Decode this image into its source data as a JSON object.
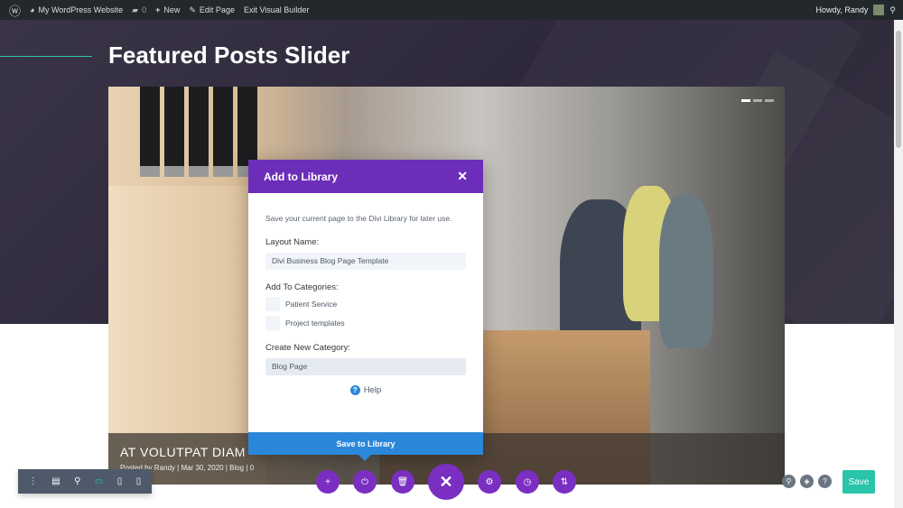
{
  "adminbar": {
    "site": "My WordPress Website",
    "comments": "0",
    "new": "New",
    "edit": "Edit Page",
    "exit": "Exit Visual Builder",
    "howdy": "Howdy, Randy"
  },
  "page": {
    "title": "Featured Posts Slider"
  },
  "slide": {
    "title": "AT VOLUTPAT DIAM",
    "meta": "Posted by Randy | Mar 30, 2020 | Blog | 0"
  },
  "modal": {
    "title": "Add to Library",
    "description": "Save your current page to the Divi Library for later use.",
    "layout_label": "Layout Name:",
    "layout_value": "Divi Business Blog Page Template",
    "categories_label": "Add To Categories:",
    "categories": [
      "Patient Service",
      "Project templates"
    ],
    "new_category_label": "Create New Category:",
    "new_category_value": "Blog Page",
    "help": "Help",
    "save": "Save to Library"
  },
  "toolbar": {
    "save": "Save",
    "colors": {
      "accent": "#7b2ec2",
      "save": "#29c4a9",
      "modal_header": "#6c2eb9",
      "modal_button": "#2b87da"
    }
  }
}
